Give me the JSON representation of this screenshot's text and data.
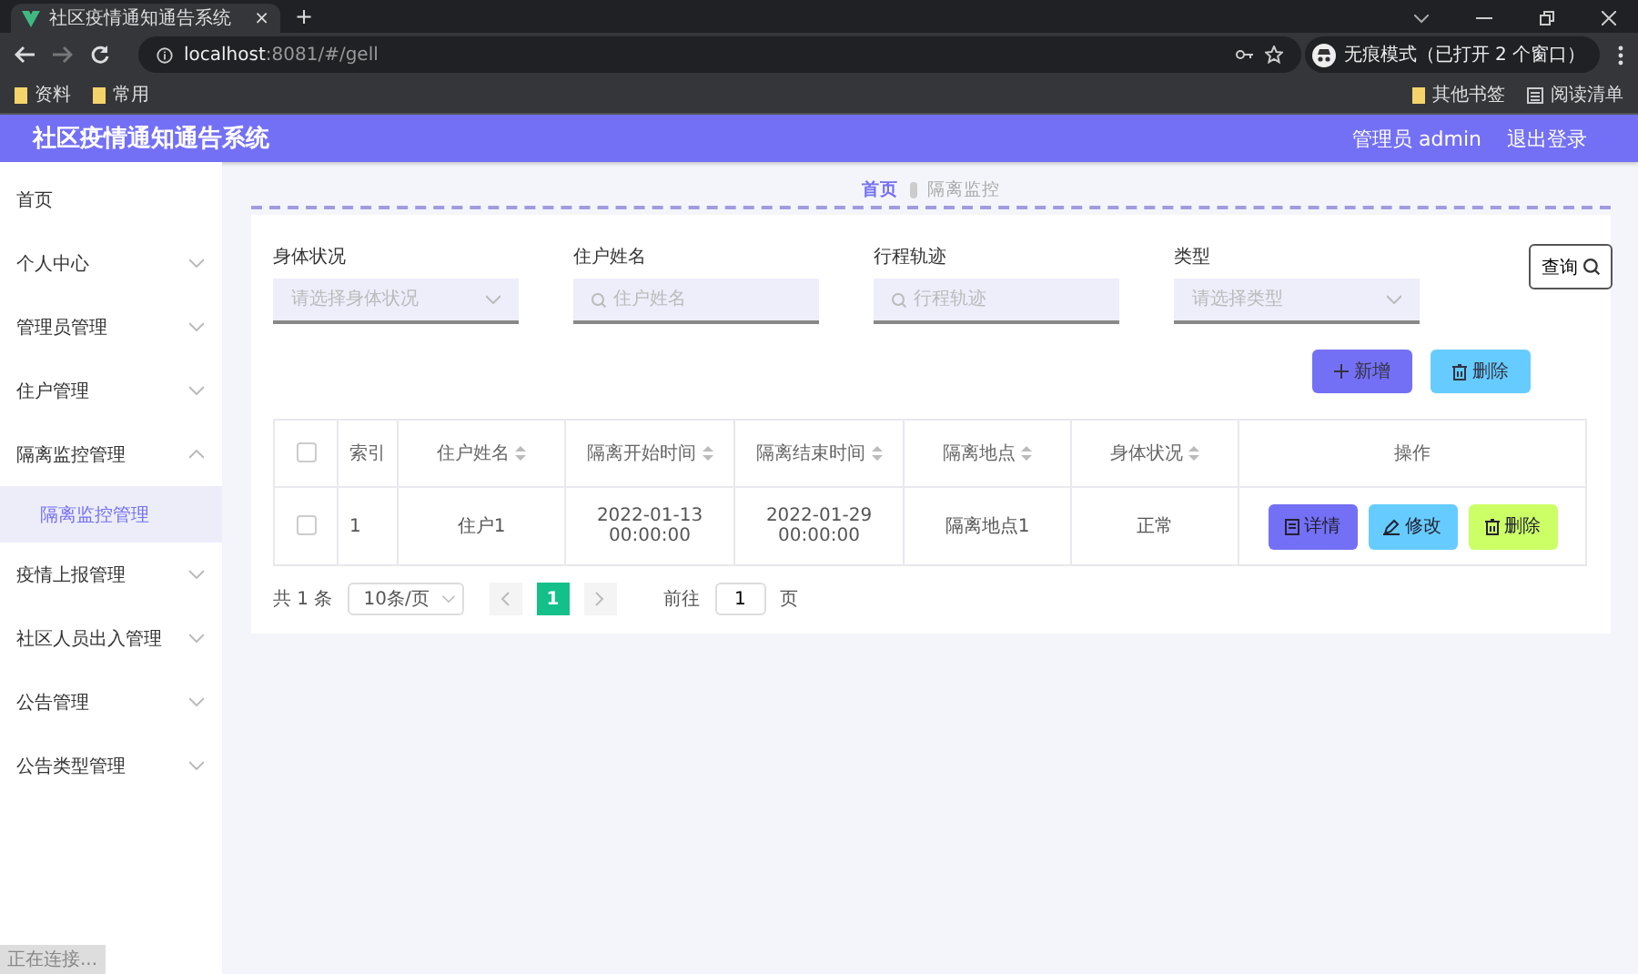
{
  "browser": {
    "tab_title": "社区疫情通知通告系统",
    "tab_close": "×",
    "new_tab": "+",
    "url_host": "localhost",
    "url_rest": ":8081/#/gell",
    "incognito": "无痕模式（已打开 2 个窗口）",
    "bookmarks": [
      "资料",
      "常用"
    ],
    "other_bookmarks": "其他书签",
    "reading_list": "阅读清单"
  },
  "header": {
    "title": "社区疫情通知通告系统",
    "user": "管理员 admin",
    "logout": "退出登录"
  },
  "sidebar": {
    "items": [
      {
        "kind": "link",
        "label": "首页"
      },
      {
        "kind": "group",
        "label": "个人中心",
        "expanded": false
      },
      {
        "kind": "group",
        "label": "管理员管理",
        "expanded": false
      },
      {
        "kind": "group",
        "label": "住户管理",
        "expanded": false
      },
      {
        "kind": "group",
        "label": "隔离监控管理",
        "expanded": true,
        "children": [
          {
            "label": "隔离监控管理",
            "selected": true
          }
        ]
      },
      {
        "kind": "group",
        "label": "疫情上报管理",
        "expanded": false
      },
      {
        "kind": "group",
        "label": "社区人员出入管理",
        "expanded": false
      },
      {
        "kind": "group",
        "label": "公告管理",
        "expanded": false
      },
      {
        "kind": "group",
        "label": "公告类型管理",
        "expanded": false
      }
    ]
  },
  "breadcrumb": [
    "首页",
    "隔离监控"
  ],
  "filters": [
    {
      "kind": "select",
      "label": "身体状况",
      "placeholder": "请选择身体状况"
    },
    {
      "kind": "search",
      "label": "住户姓名",
      "placeholder": "住户姓名"
    },
    {
      "kind": "search",
      "label": "行程轨迹",
      "placeholder": "行程轨迹"
    },
    {
      "kind": "select",
      "label": "类型",
      "placeholder": "请选择类型"
    }
  ],
  "query_button": "查询",
  "actions": [
    {
      "kind": "add",
      "label": "新增"
    },
    {
      "kind": "delete",
      "label": "删除"
    }
  ],
  "table": {
    "select_all_checked": false,
    "columns": [
      {
        "label": "索引",
        "sortable": false
      },
      {
        "label": "住户姓名",
        "sortable": true
      },
      {
        "label": "隔离开始时间",
        "sortable": true
      },
      {
        "label": "隔离结束时间",
        "sortable": true
      },
      {
        "label": "隔离地点",
        "sortable": true
      },
      {
        "label": "身体状况",
        "sortable": true
      },
      {
        "label": "操作",
        "sortable": false
      }
    ],
    "rows": [
      {
        "checked": false,
        "cells": [
          "1",
          "住户1",
          "2022-01-13 00:00:00",
          "2022-01-29 00:00:00",
          "隔离地点1",
          "正常"
        ],
        "buttons": [
          {
            "kind": "detail",
            "label": "详情"
          },
          {
            "kind": "edit",
            "label": "修改"
          },
          {
            "kind": "delete",
            "label": "删除"
          }
        ]
      }
    ]
  },
  "pagination": {
    "total": "共 1 条",
    "page_size": "10条/页",
    "pages": [
      {
        "label": "1",
        "selected": true
      }
    ],
    "goto_label": "前往",
    "goto_value": "1",
    "page_unit": "页"
  },
  "status_bar": "正在连接..."
}
